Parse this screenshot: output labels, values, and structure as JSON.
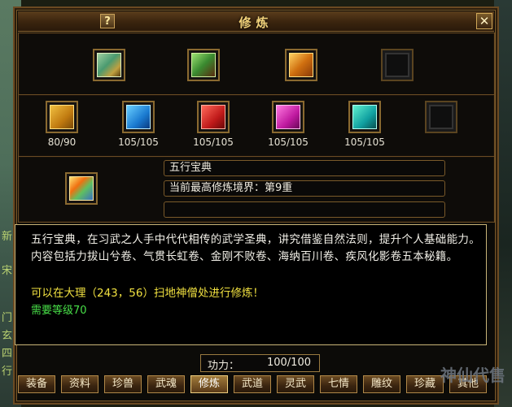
{
  "window": {
    "title": "修炼",
    "help_label": "?",
    "close_label": "✕"
  },
  "background": {
    "side_chars": [
      "新",
      "宋",
      "门",
      "玄",
      "四",
      "行"
    ]
  },
  "top_slots": [
    {
      "name": "book-stack",
      "icon": "book-stack-icon"
    },
    {
      "name": "scroll-bundle",
      "icon": "scroll-bundle-icon"
    },
    {
      "name": "treasure-chest",
      "icon": "treasure-chest-icon"
    },
    {
      "name": "empty",
      "icon": "empty-slot-icon"
    }
  ],
  "book_slots": [
    {
      "icon": "yellow-book-icon",
      "count": "80/90"
    },
    {
      "icon": "blue-book-icon",
      "count": "105/105"
    },
    {
      "icon": "red-book-icon",
      "count": "105/105"
    },
    {
      "icon": "pink-book-icon",
      "count": "105/105"
    },
    {
      "icon": "teal-book-icon",
      "count": "105/105"
    },
    {
      "icon": "empty-slot-icon",
      "count": ""
    }
  ],
  "selected": {
    "icon": "multicolor-book-icon",
    "name": "五行宝典",
    "realm": "当前最高修炼境界：第9重",
    "extra": ""
  },
  "description": {
    "text": "五行宝典，在习武之人手中代代相传的武学圣典，讲究借鉴自然法则，提升个人基础能力。内容包括力拔山兮卷、气贯长虹卷、金刚不败卷、海纳百川卷、疾风化影卷五本秘籍。",
    "location": "可以在大理（243，56）扫地神僧处进行修炼！",
    "requirement": "需要等级70"
  },
  "power": {
    "label": "功力：",
    "value": "100/100"
  },
  "tabs": [
    {
      "label": "装备",
      "active": false
    },
    {
      "label": "资料",
      "active": false
    },
    {
      "label": "珍兽",
      "active": false
    },
    {
      "label": "武魂",
      "active": false
    },
    {
      "label": "修炼",
      "active": true
    },
    {
      "label": "武道",
      "active": false
    },
    {
      "label": "灵武",
      "active": false
    },
    {
      "label": "七情",
      "active": false
    },
    {
      "label": "雕纹",
      "active": false
    },
    {
      "label": "珍藏",
      "active": false
    },
    {
      "label": "其他",
      "active": false
    }
  ],
  "watermark": "神仙代售"
}
